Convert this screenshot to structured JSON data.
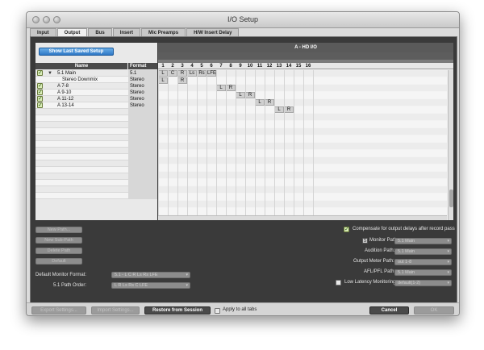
{
  "window": {
    "title": "I/O Setup"
  },
  "tabs": [
    {
      "label": "Input"
    },
    {
      "label": "Output"
    },
    {
      "label": "Bus"
    },
    {
      "label": "Insert"
    },
    {
      "label": "Mic Preamps"
    },
    {
      "label": "H/W Insert Delay"
    }
  ],
  "active_tab": "Output",
  "top": {
    "show_saved_label": "Show Last Saved Setup",
    "col_name": "Name",
    "col_format": "Format",
    "device": "A - HD I/O",
    "channels": [
      "1",
      "2",
      "3",
      "4",
      "5",
      "6",
      "7",
      "8",
      "9",
      "10",
      "11",
      "12",
      "13",
      "14",
      "15",
      "16"
    ]
  },
  "paths": [
    {
      "name": "5.1 Main",
      "format": "5.1",
      "checked": true,
      "expander": "▼",
      "assignments": [
        [
          "L",
          1
        ],
        [
          "C",
          2
        ],
        [
          "R",
          3
        ],
        [
          "Ls",
          4
        ],
        [
          "Rs",
          5
        ],
        [
          "LFE",
          6
        ]
      ]
    },
    {
      "name": "Stereo Downmix",
      "format": "Stereo",
      "checked": false,
      "expander": "",
      "assignments": [
        [
          "L",
          1
        ],
        [
          "R",
          3
        ]
      ]
    },
    {
      "name": "A 7-8",
      "format": "Stereo",
      "checked": true,
      "expander": "",
      "assignments": [
        [
          "L",
          7
        ],
        [
          "R",
          8
        ]
      ]
    },
    {
      "name": "A 9-10",
      "format": "Stereo",
      "checked": true,
      "expander": "",
      "assignments": [
        [
          "L",
          9
        ],
        [
          "R",
          10
        ]
      ]
    },
    {
      "name": "A 11-12",
      "format": "Stereo",
      "checked": true,
      "expander": "",
      "assignments": [
        [
          "L",
          11
        ],
        [
          "R",
          12
        ]
      ]
    },
    {
      "name": "A 13-14",
      "format": "Stereo",
      "checked": true,
      "expander": "",
      "assignments": [
        [
          "L",
          13
        ],
        [
          "R",
          14
        ]
      ]
    }
  ],
  "path_buttons": {
    "new_path": "New Path...",
    "new_sub_path": "New Sub-Path",
    "delete_path": "Delete Path",
    "default": "Default"
  },
  "defaults": {
    "monitor_format_label": "Default Monitor Format:",
    "monitor_format_value": "5.1 - L C R Ls Rs LFE",
    "path_order_label": "5.1 Path Order:",
    "path_order_value": "L R Ls Rs C LFE"
  },
  "options": {
    "compensate_label": "Compensate for output delays after record pass",
    "compensate_checked": true,
    "monitor_path_label": "Monitor Path:",
    "monitor_path_value": "5.1 Main",
    "audition_path_label": "Audition Path:",
    "audition_path_value": "5.1 Main",
    "output_meter_label": "Output Meter Path:",
    "output_meter_value": "out 1-8",
    "afl_pfl_label": "AFL/PFL Path:",
    "afl_pfl_value": "5.1 Main",
    "low_latency_label": "Low Latency Monitoring:",
    "low_latency_checked": false,
    "low_latency_value": "default(1-2)"
  },
  "footer": {
    "export_label": "Export Settings...",
    "import_label": "Import Settings...",
    "restore_label": "Restore from Session",
    "apply_all_label": "Apply to all tabs",
    "apply_all_checked": false,
    "cancel_label": "Cancel",
    "ok_label": "OK"
  },
  "colors": {
    "accent_blue": "#3b86d4",
    "check_green": "#d9ecb8",
    "panel_dark": "#3a3a3a"
  }
}
